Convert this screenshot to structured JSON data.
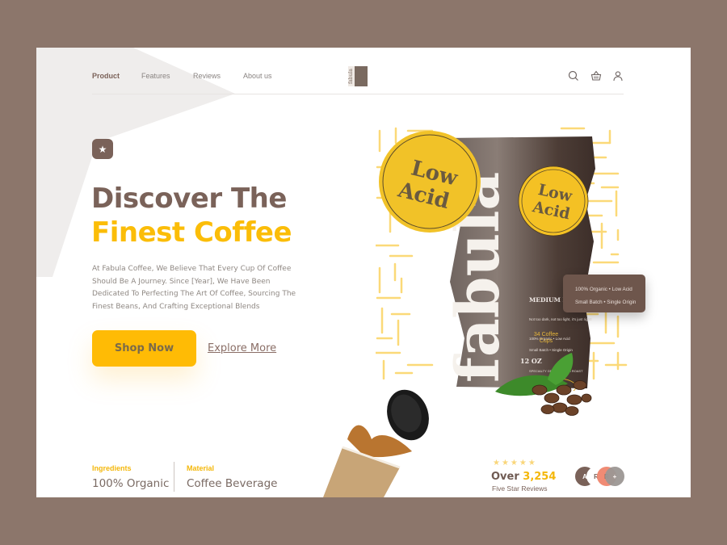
{
  "nav": {
    "items": [
      {
        "label": "Product",
        "active": true
      },
      {
        "label": "Features",
        "active": false
      },
      {
        "label": "Reviews",
        "active": false
      },
      {
        "label": "About us",
        "active": false
      }
    ],
    "logo_text": "fabula",
    "icons": [
      "search-icon",
      "basket-icon",
      "user-icon"
    ]
  },
  "hero": {
    "badge_icon": "star-icon",
    "title_line1": "Discover The",
    "title_line2_a": "Finest ",
    "title_line2_b": "Coffee",
    "description": "At Fabula  Coffee, We Believe That Every Cup Of Coffee Should Be A Journey. Since [Year], We Have Been Dedicated To Perfecting The Art Of Coffee, Sourcing The Finest Beans, And Crafting Exceptional Blends",
    "primary_cta": "Shop Now",
    "secondary_cta": "Explore More"
  },
  "stats": [
    {
      "label": "Ingredients",
      "value": "100% Organic"
    },
    {
      "label": "Material",
      "value": "Coffee Beverage"
    }
  ],
  "product": {
    "brand": "fabula",
    "sticker_big": [
      "Low",
      "Acid"
    ],
    "sticker_small": [
      "Low",
      "Acid"
    ],
    "bag_title": "MEDIUM ROAST COFFEE",
    "bag_tagline": "Not too dark, not too light, it's just right!",
    "bag_feature1": "100% Organic • Low Acid",
    "bag_feature2": "Small Batch • Single Origin",
    "bag_grade": "SPECIALTY GRADE FRESH ROAST",
    "bag_cups": "34 Coffee Cups",
    "bag_weight": "12 OZ"
  },
  "tooltip": {
    "line1": "100% Organic • Low Acid",
    "line2": "Small Batch • Single Origin"
  },
  "reviews": {
    "stars": "★★★★★",
    "rating_stars": 5,
    "prefix": "Over ",
    "count": "3,254",
    "label": "Five Star Reviews",
    "avatars": [
      {
        "initial": "A",
        "color": "#7a6259"
      },
      {
        "initial": "R",
        "color": "#ffffff"
      },
      {
        "initial": "R",
        "color": "#f08b74"
      },
      {
        "initial": "+",
        "color": "#9c9794"
      }
    ]
  },
  "colors": {
    "brand_brown": "#7a6259",
    "accent_yellow": "#fbbd08",
    "background": "#8c766b"
  }
}
